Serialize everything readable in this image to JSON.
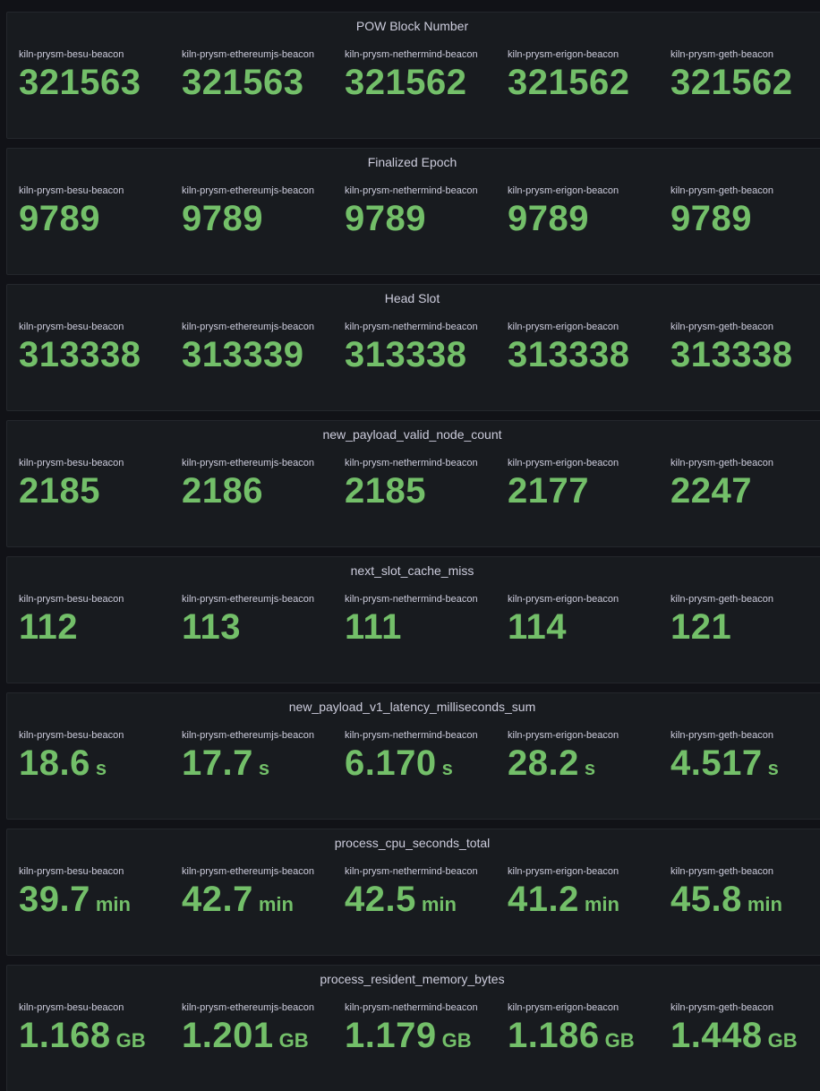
{
  "colors": {
    "background": "#111217",
    "panel": "#181b1f",
    "value": "#73bf69",
    "text": "#ccccdc"
  },
  "panels": [
    {
      "title": "POW Block Number",
      "stats": [
        {
          "label": "kiln-prysm-besu-beacon",
          "value": "321563",
          "unit": ""
        },
        {
          "label": "kiln-prysm-ethereumjs-beacon",
          "value": "321563",
          "unit": ""
        },
        {
          "label": "kiln-prysm-nethermind-beacon",
          "value": "321562",
          "unit": ""
        },
        {
          "label": "kiln-prysm-erigon-beacon",
          "value": "321562",
          "unit": ""
        },
        {
          "label": "kiln-prysm-geth-beacon",
          "value": "321562",
          "unit": ""
        }
      ]
    },
    {
      "title": "Finalized Epoch",
      "stats": [
        {
          "label": "kiln-prysm-besu-beacon",
          "value": "9789",
          "unit": ""
        },
        {
          "label": "kiln-prysm-ethereumjs-beacon",
          "value": "9789",
          "unit": ""
        },
        {
          "label": "kiln-prysm-nethermind-beacon",
          "value": "9789",
          "unit": ""
        },
        {
          "label": "kiln-prysm-erigon-beacon",
          "value": "9789",
          "unit": ""
        },
        {
          "label": "kiln-prysm-geth-beacon",
          "value": "9789",
          "unit": ""
        }
      ]
    },
    {
      "title": "Head Slot",
      "stats": [
        {
          "label": "kiln-prysm-besu-beacon",
          "value": "313338",
          "unit": ""
        },
        {
          "label": "kiln-prysm-ethereumjs-beacon",
          "value": "313339",
          "unit": ""
        },
        {
          "label": "kiln-prysm-nethermind-beacon",
          "value": "313338",
          "unit": ""
        },
        {
          "label": "kiln-prysm-erigon-beacon",
          "value": "313338",
          "unit": ""
        },
        {
          "label": "kiln-prysm-geth-beacon",
          "value": "313338",
          "unit": ""
        }
      ]
    },
    {
      "title": "new_payload_valid_node_count",
      "stats": [
        {
          "label": "kiln-prysm-besu-beacon",
          "value": "2185",
          "unit": ""
        },
        {
          "label": "kiln-prysm-ethereumjs-beacon",
          "value": "2186",
          "unit": ""
        },
        {
          "label": "kiln-prysm-nethermind-beacon",
          "value": "2185",
          "unit": ""
        },
        {
          "label": "kiln-prysm-erigon-beacon",
          "value": "2177",
          "unit": ""
        },
        {
          "label": "kiln-prysm-geth-beacon",
          "value": "2247",
          "unit": ""
        }
      ]
    },
    {
      "title": "next_slot_cache_miss",
      "stats": [
        {
          "label": "kiln-prysm-besu-beacon",
          "value": "112",
          "unit": ""
        },
        {
          "label": "kiln-prysm-ethereumjs-beacon",
          "value": "113",
          "unit": ""
        },
        {
          "label": "kiln-prysm-nethermind-beacon",
          "value": "111",
          "unit": ""
        },
        {
          "label": "kiln-prysm-erigon-beacon",
          "value": "114",
          "unit": ""
        },
        {
          "label": "kiln-prysm-geth-beacon",
          "value": "121",
          "unit": ""
        }
      ]
    },
    {
      "title": "new_payload_v1_latency_milliseconds_sum",
      "stats": [
        {
          "label": "kiln-prysm-besu-beacon",
          "value": "18.6",
          "unit": "s"
        },
        {
          "label": "kiln-prysm-ethereumjs-beacon",
          "value": "17.7",
          "unit": "s"
        },
        {
          "label": "kiln-prysm-nethermind-beacon",
          "value": "6.170",
          "unit": "s"
        },
        {
          "label": "kiln-prysm-erigon-beacon",
          "value": "28.2",
          "unit": "s"
        },
        {
          "label": "kiln-prysm-geth-beacon",
          "value": "4.517",
          "unit": "s"
        }
      ]
    },
    {
      "title": "process_cpu_seconds_total",
      "stats": [
        {
          "label": "kiln-prysm-besu-beacon",
          "value": "39.7",
          "unit": "min"
        },
        {
          "label": "kiln-prysm-ethereumjs-beacon",
          "value": "42.7",
          "unit": "min"
        },
        {
          "label": "kiln-prysm-nethermind-beacon",
          "value": "42.5",
          "unit": "min"
        },
        {
          "label": "kiln-prysm-erigon-beacon",
          "value": "41.2",
          "unit": "min"
        },
        {
          "label": "kiln-prysm-geth-beacon",
          "value": "45.8",
          "unit": "min"
        }
      ]
    },
    {
      "title": "process_resident_memory_bytes",
      "stats": [
        {
          "label": "kiln-prysm-besu-beacon",
          "value": "1.168",
          "unit": "GB"
        },
        {
          "label": "kiln-prysm-ethereumjs-beacon",
          "value": "1.201",
          "unit": "GB"
        },
        {
          "label": "kiln-prysm-nethermind-beacon",
          "value": "1.179",
          "unit": "GB"
        },
        {
          "label": "kiln-prysm-erigon-beacon",
          "value": "1.186",
          "unit": "GB"
        },
        {
          "label": "kiln-prysm-geth-beacon",
          "value": "1.448",
          "unit": "GB"
        }
      ]
    }
  ]
}
